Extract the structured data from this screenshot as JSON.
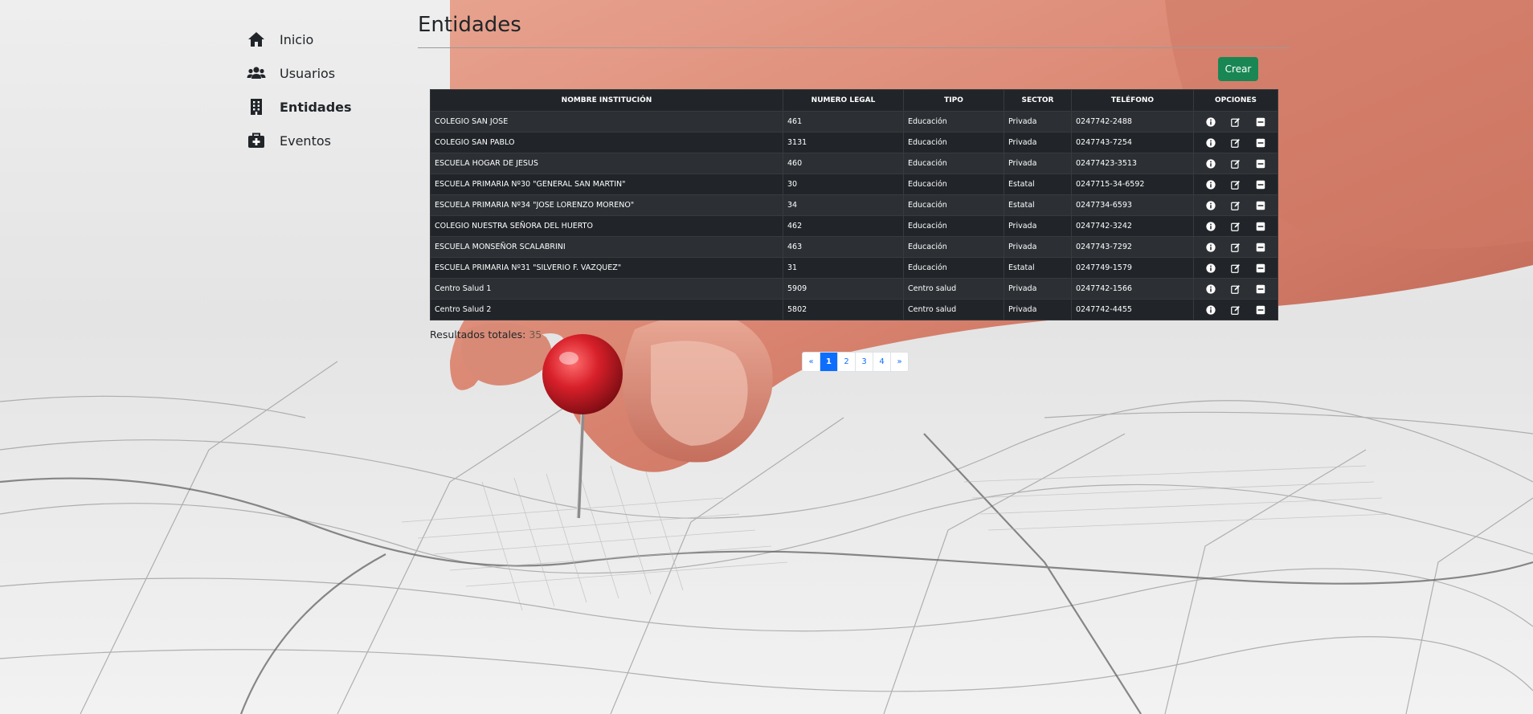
{
  "sidebar": {
    "items": [
      {
        "label": "Inicio",
        "icon": "home-icon",
        "active": false
      },
      {
        "label": "Usuarios",
        "icon": "users-icon",
        "active": false
      },
      {
        "label": "Entidades",
        "icon": "building-icon",
        "active": true
      },
      {
        "label": "Eventos",
        "icon": "medical-kit-icon",
        "active": false
      }
    ]
  },
  "main": {
    "title": "Entidades",
    "create_label": "Crear",
    "create_color": "#198754"
  },
  "table": {
    "headers": [
      "NOMBRE INSTITUCIÓN",
      "NUMERO LEGAL",
      "TIPO",
      "SECTOR",
      "TELÉFONO",
      "OPCIONES"
    ],
    "rows": [
      [
        "COLEGIO SAN JOSE",
        "461",
        "Educación",
        "Privada",
        "0247742-2488"
      ],
      [
        "COLEGIO SAN PABLO",
        "3131",
        "Educación",
        "Privada",
        "0247743-7254"
      ],
      [
        "ESCUELA HOGAR DE JESUS",
        "460",
        "Educación",
        "Privada",
        "02477423-3513"
      ],
      [
        "ESCUELA PRIMARIA Nº30 \"GENERAL SAN MARTIN\"",
        "30",
        "Educación",
        "Estatal",
        "0247715-34-6592"
      ],
      [
        "ESCUELA PRIMARIA Nº34 \"JOSE LORENZO MORENO\"",
        "34",
        "Educación",
        "Estatal",
        "0247734-6593"
      ],
      [
        "COLEGIO NUESTRA SEÑORA DEL HUERTO",
        "462",
        "Educación",
        "Privada",
        "0247742-3242"
      ],
      [
        "ESCUELA MONSEÑOR SCALABRINI",
        "463",
        "Educación",
        "Privada",
        "0247743-7292"
      ],
      [
        "ESCUELA PRIMARIA Nº31 \"SILVERIO F. VAZQUEZ\"",
        "31",
        "Educación",
        "Estatal",
        "0247749-1579"
      ],
      [
        "Centro Salud 1",
        "5909",
        "Centro salud",
        "Privada",
        "0247742-1566"
      ],
      [
        "Centro Salud 2",
        "5802",
        "Centro salud",
        "Privada",
        "0247742-4455"
      ]
    ],
    "option_icons": [
      "info-icon",
      "edit-icon",
      "delete-icon"
    ]
  },
  "results": {
    "label": "Resultados totales:",
    "total": "35"
  },
  "pagination": {
    "prev": "«",
    "pages": [
      "1",
      "2",
      "3",
      "4"
    ],
    "current": "1",
    "next": "»",
    "active_color": "#0d6efd"
  }
}
